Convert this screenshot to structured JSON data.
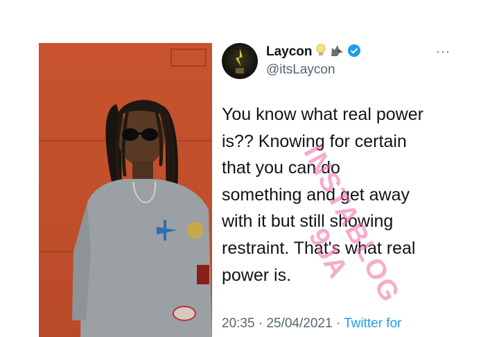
{
  "tweet": {
    "display_name": "Laycon",
    "handle": "@itsLaycon",
    "emoji_icons": [
      "lightbulb-icon",
      "wolf-icon"
    ],
    "verified_color": "#1d9bf0",
    "text_lines": [
      "You know what real power",
      "is?? Knowing for certain",
      "that you can do",
      "something and get away",
      "with it but still showing",
      "restraint. That's what real",
      "power is."
    ],
    "time": "20:35",
    "separator": "·",
    "date": "25/04/2021",
    "source": "Twitter for",
    "more_label": "···"
  },
  "watermark": {
    "line1": "INSTABLOG",
    "line2": "9JA",
    "color": "#f06aa0"
  },
  "colors": {
    "wall": "#c2502c",
    "text": "#0f1419",
    "muted": "#536471"
  }
}
